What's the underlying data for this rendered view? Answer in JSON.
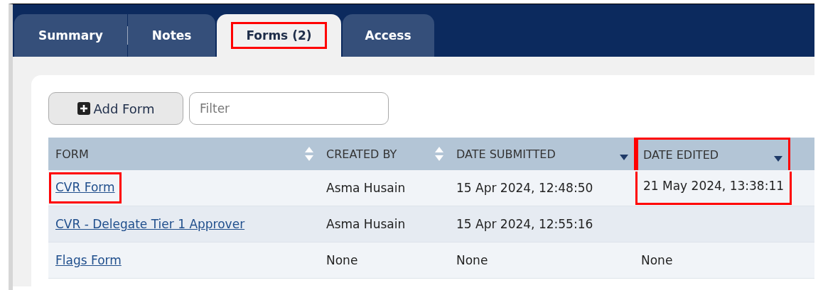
{
  "tabs": [
    {
      "label": "Summary",
      "selected": false,
      "highlighted": false
    },
    {
      "label": "Notes",
      "selected": false,
      "highlighted": false
    },
    {
      "label": "Forms (2)",
      "selected": true,
      "highlighted": true
    },
    {
      "label": "Access",
      "selected": false,
      "highlighted": false
    }
  ],
  "toolbar": {
    "add_button": "Add Form",
    "filter": {
      "placeholder": "Filter"
    }
  },
  "table": {
    "columns": [
      {
        "label": "FORM",
        "sorted": false,
        "highlighted": false
      },
      {
        "label": "CREATED BY",
        "sorted": false,
        "highlighted": false
      },
      {
        "label": "DATE SUBMITTED",
        "sorted": true,
        "highlighted": false
      },
      {
        "label": "DATE EDITED",
        "sorted": true,
        "highlighted": true
      }
    ],
    "rows": [
      {
        "cells": [
          {
            "text": "CVR Form",
            "highlighted": true
          },
          {
            "text": "Asma Husain",
            "highlighted": false
          },
          {
            "text": "15 Apr 2024, 12:48:50",
            "highlighted": false
          },
          {
            "text": "21 May 2024, 13:38:11",
            "highlighted": true
          }
        ]
      },
      {
        "cells": [
          {
            "text": "CVR - Delegate Tier 1 Approver",
            "highlighted": false
          },
          {
            "text": "Asma Husain",
            "highlighted": false
          },
          {
            "text": "15 Apr 2024, 12:55:16",
            "highlighted": false
          }
        ]
      },
      {
        "cells": [
          {
            "text": "Flags Form",
            "highlighted": false
          },
          {
            "text": "None",
            "highlighted": false
          },
          {
            "text": "None",
            "highlighted": false
          },
          {
            "text": "None",
            "highlighted": false
          }
        ]
      }
    ]
  }
}
